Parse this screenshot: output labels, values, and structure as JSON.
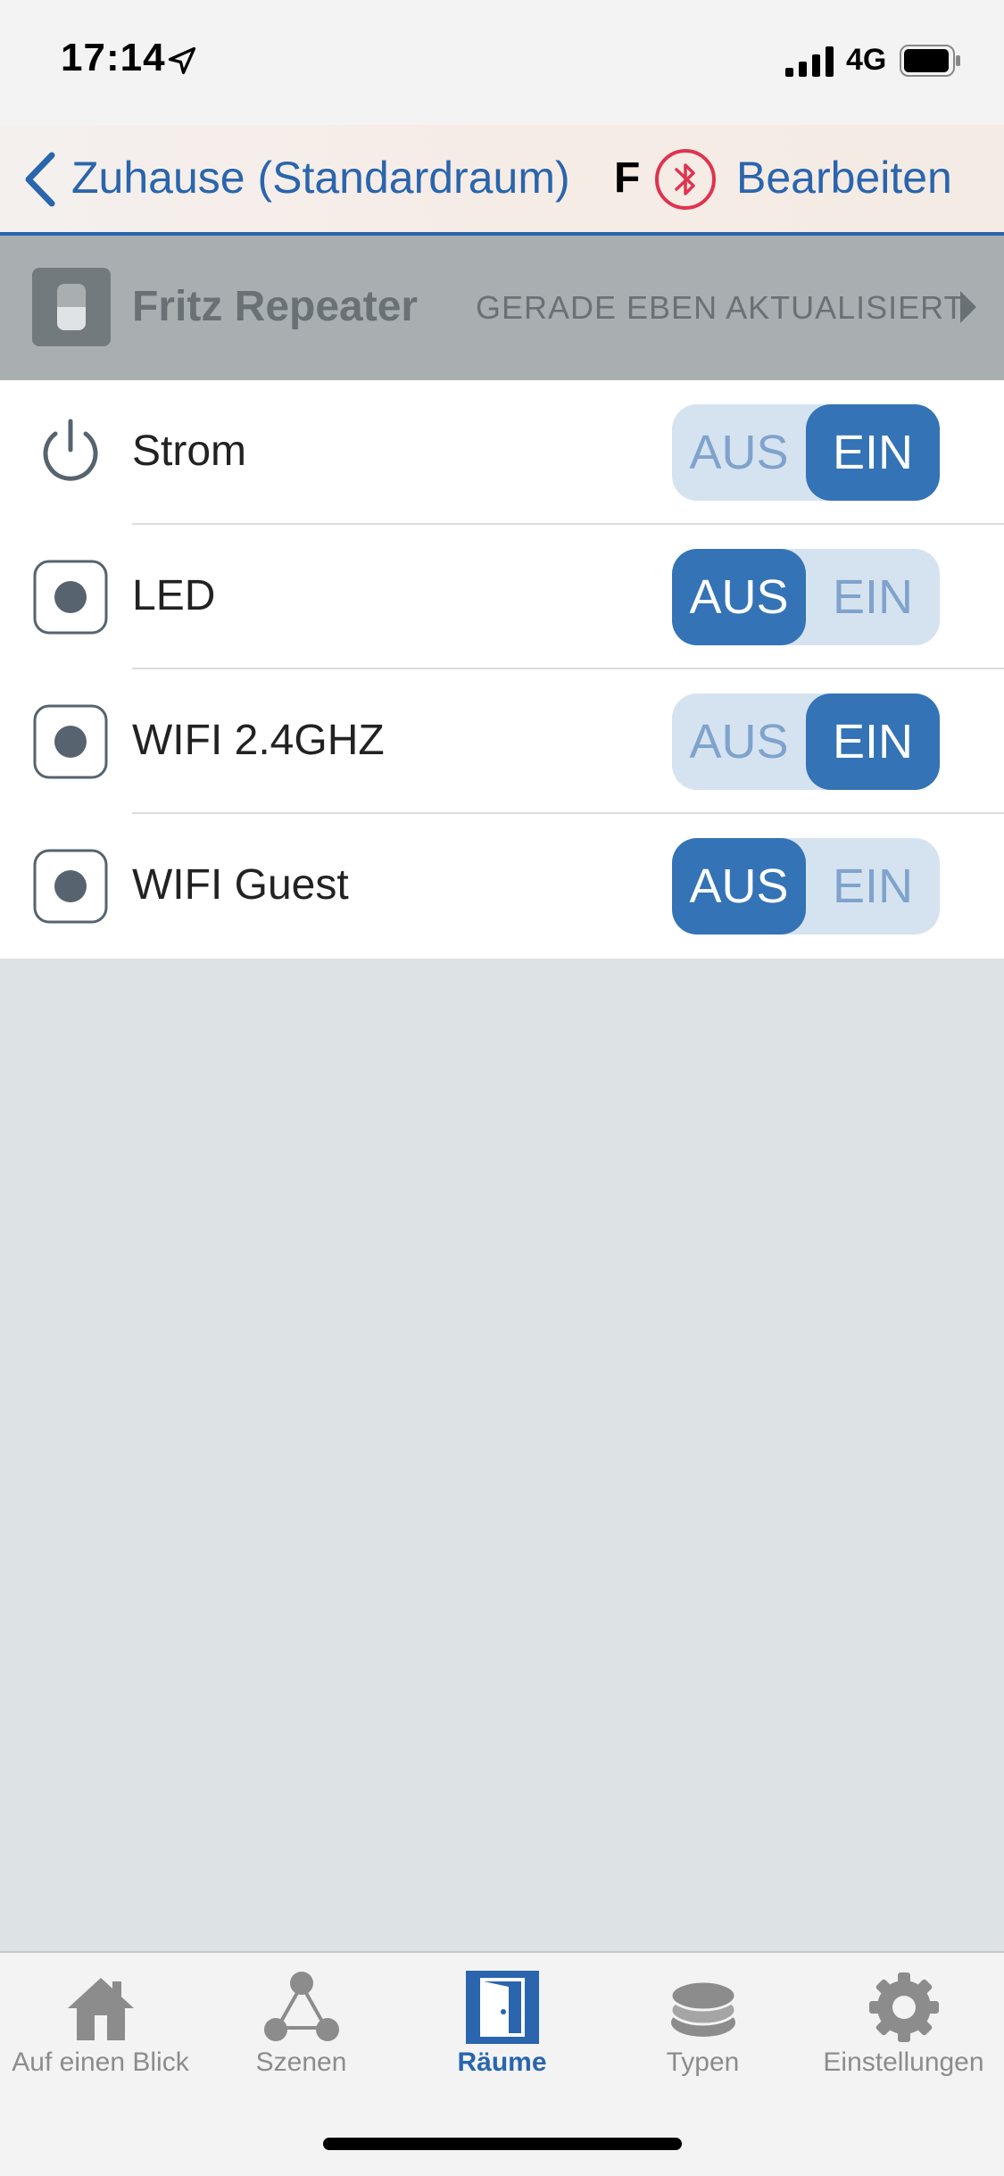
{
  "status": {
    "time": "17:14",
    "network": "4G",
    "icons": [
      "location-arrow-icon",
      "signal-bars-icon",
      "battery-icon"
    ]
  },
  "nav": {
    "back_label": "Zuhause (Standardraum)",
    "title_truncated": "Fr",
    "bluetooth_icon": "bluetooth-icon",
    "edit_label": "Bearbeiten",
    "accent_color": "#2a65ad",
    "bluetooth_color": "#e0334f"
  },
  "device": {
    "name": "Fritz Repeater",
    "status": "GERADE EBEN AKTUALISIERT",
    "icon": "switch-device-icon"
  },
  "switches": [
    {
      "label": "Strom",
      "icon": "power-icon",
      "off_label": "AUS",
      "on_label": "EIN",
      "state": "EIN"
    },
    {
      "label": "LED",
      "icon": "outlet-icon",
      "off_label": "AUS",
      "on_label": "EIN",
      "state": "AUS"
    },
    {
      "label": "WIFI 2.4GHZ",
      "icon": "outlet-icon",
      "off_label": "AUS",
      "on_label": "EIN",
      "state": "EIN"
    },
    {
      "label": "WIFI Guest",
      "icon": "outlet-icon",
      "off_label": "AUS",
      "on_label": "EIN",
      "state": "AUS"
    }
  ],
  "tabs": [
    {
      "label": "Auf einen Blick",
      "icon": "home-icon",
      "active": false
    },
    {
      "label": "Szenen",
      "icon": "scenes-icon",
      "active": false
    },
    {
      "label": "Räume",
      "icon": "door-icon",
      "active": true
    },
    {
      "label": "Typen",
      "icon": "layers-icon",
      "active": false
    },
    {
      "label": "Einstellungen",
      "icon": "gear-icon",
      "active": false
    }
  ]
}
